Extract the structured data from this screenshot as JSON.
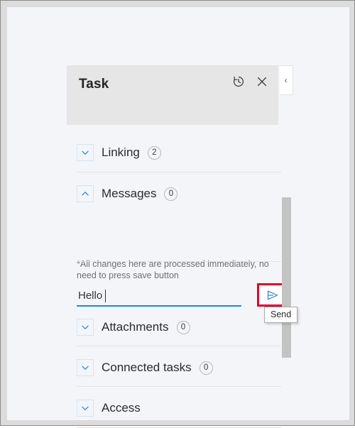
{
  "panel": {
    "title": "Task",
    "header_icons": [
      {
        "name": "history-icon",
        "label": "History"
      },
      {
        "name": "close-icon",
        "label": "Close"
      }
    ],
    "collapse_tab": {
      "name": "collapse-panel-tab",
      "glyph": "‹"
    }
  },
  "sections": [
    {
      "id": "linking",
      "label": "Linking",
      "count": "2",
      "expanded": false
    },
    {
      "id": "messages",
      "label": "Messages",
      "count": "0",
      "expanded": true
    },
    {
      "id": "attachments",
      "label": "Attachments",
      "count": "0",
      "expanded": false
    },
    {
      "id": "connected-tasks",
      "label": "Connected tasks",
      "count": "0",
      "expanded": false
    },
    {
      "id": "access",
      "label": "Access",
      "count": "",
      "expanded": false
    }
  ],
  "messages": {
    "note": "*All changes here are processed immediately, no need to press save button",
    "input_value": "Hello",
    "input_placeholder": "",
    "send_button_label": "Send",
    "tooltip_text": "Send"
  },
  "colors": {
    "accent_blue": "#1a8ad4",
    "highlight_red": "#e3002b",
    "header_gray": "#e6e6e6",
    "page_background": "#f4f5f9",
    "scrollbar_thumb": "#c3c3c3"
  }
}
